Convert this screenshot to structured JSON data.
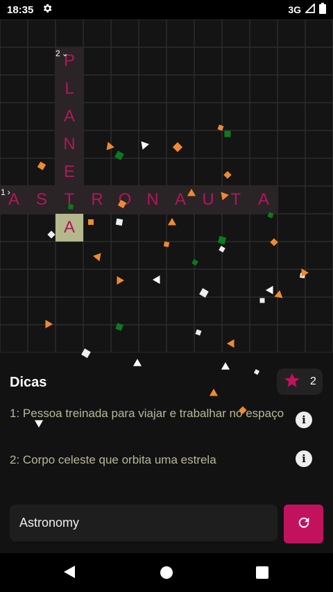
{
  "status_bar": {
    "time": "18:35",
    "network": "3G"
  },
  "board": {
    "clue_numbers": [
      "2",
      "1"
    ],
    "clue_arrows": [
      "⌄",
      "›"
    ],
    "across_word": [
      "A",
      "S",
      "T",
      "R",
      "O",
      "N",
      "A",
      "U",
      "T",
      "A"
    ],
    "down_word": [
      "P",
      "L",
      "A",
      "N",
      "E",
      "T",
      "A"
    ]
  },
  "clues": {
    "title": "Dicas",
    "score": "2",
    "items": [
      {
        "text": "1: Pessoa treinada para viajar e trabalhar no espaço"
      },
      {
        "text": "2: Corpo celeste que orbita uma estrela"
      }
    ]
  },
  "answer": {
    "value": "Astronomy"
  },
  "colors": {
    "accent": "#c2125e",
    "letters": "#b0185a",
    "active_cell": "#b4b88c",
    "clue_text": "#b8b898"
  },
  "icons": {
    "settings": "gear-icon",
    "signal": "signal-icon",
    "battery": "battery-icon",
    "star": "star-icon",
    "info": "info-icon",
    "refresh": "refresh-icon",
    "back": "back-icon",
    "home": "home-icon",
    "recents": "recents-icon"
  }
}
